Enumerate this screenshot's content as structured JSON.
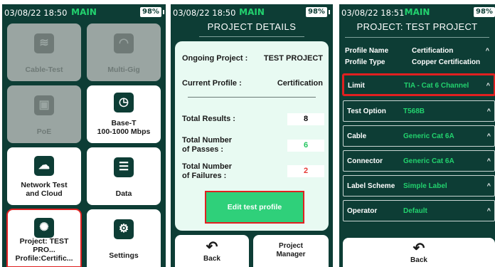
{
  "panel1": {
    "status": {
      "time": "03/08/22 18:50",
      "mode": "MAIN",
      "battery": "98%"
    },
    "tiles": [
      {
        "label": "Cable-Test",
        "icon": "cable-icon",
        "glyph": "≋"
      },
      {
        "label": "Multi-Gig",
        "icon": "speedometer-icon",
        "glyph": "◠"
      },
      {
        "label": "PoE",
        "icon": "ethernet-port-icon",
        "glyph": "▣"
      },
      {
        "label1": "Base-T",
        "label2": "100-1000 Mbps",
        "icon": "stopwatch-icon",
        "glyph": "◷"
      },
      {
        "label1": "Network Test",
        "label2": "and Cloud",
        "icon": "cloud-icon",
        "glyph": "☁"
      },
      {
        "label": "Data",
        "icon": "database-icon",
        "glyph": "☰"
      },
      {
        "label1": "Project: TEST PRO...",
        "label2": "Profile:Certific...",
        "icon": "lightbulb-icon",
        "glyph": "✺"
      },
      {
        "label": "Settings",
        "icon": "gear-icon",
        "glyph": "⚙"
      }
    ]
  },
  "panel2": {
    "status": {
      "time": "03/08/22 18:50",
      "mode": "MAIN",
      "battery": "98%"
    },
    "title": "PROJECT DETAILS",
    "ongoing_label": "Ongoing Project :",
    "ongoing_value": "TEST PROJECT",
    "profile_label": "Current Profile :",
    "profile_value": "Certification",
    "total_results_label": "Total Results :",
    "total_results": "8",
    "passes_label1": "Total Number",
    "passes_label2": "of Passes :",
    "passes": "6",
    "failures_label1": "Total Number",
    "failures_label2": "of Failures :",
    "failures": "2",
    "edit_button": "Edit test profile",
    "back_label": "Back",
    "pm_label1": "Project",
    "pm_label2": "Manager",
    "colors": {
      "pass": "#22c55e",
      "fail": "#e53935"
    }
  },
  "panel3": {
    "status": {
      "time": "03/08/22 18:51",
      "mode": "MAIN",
      "battery": "98%"
    },
    "title": "PROJECT: TEST PROJECT",
    "profile_name_label": "Profile Name",
    "profile_name_value": "Certification",
    "profile_type_label": "Profile Type",
    "profile_type_value": "Copper Certification",
    "settings": [
      {
        "key": "Limit",
        "value": "TIA - Cat 6 Channel"
      },
      {
        "key": "Test Option",
        "value": "T568B"
      },
      {
        "key": "Cable",
        "value": "Generic Cat 6A"
      },
      {
        "key": "Connector",
        "value": "Generic Cat 6A"
      },
      {
        "key": "Label Scheme",
        "value": "Simple Label"
      },
      {
        "key": "Operator",
        "value": "Default"
      }
    ],
    "back_label": "Back"
  }
}
